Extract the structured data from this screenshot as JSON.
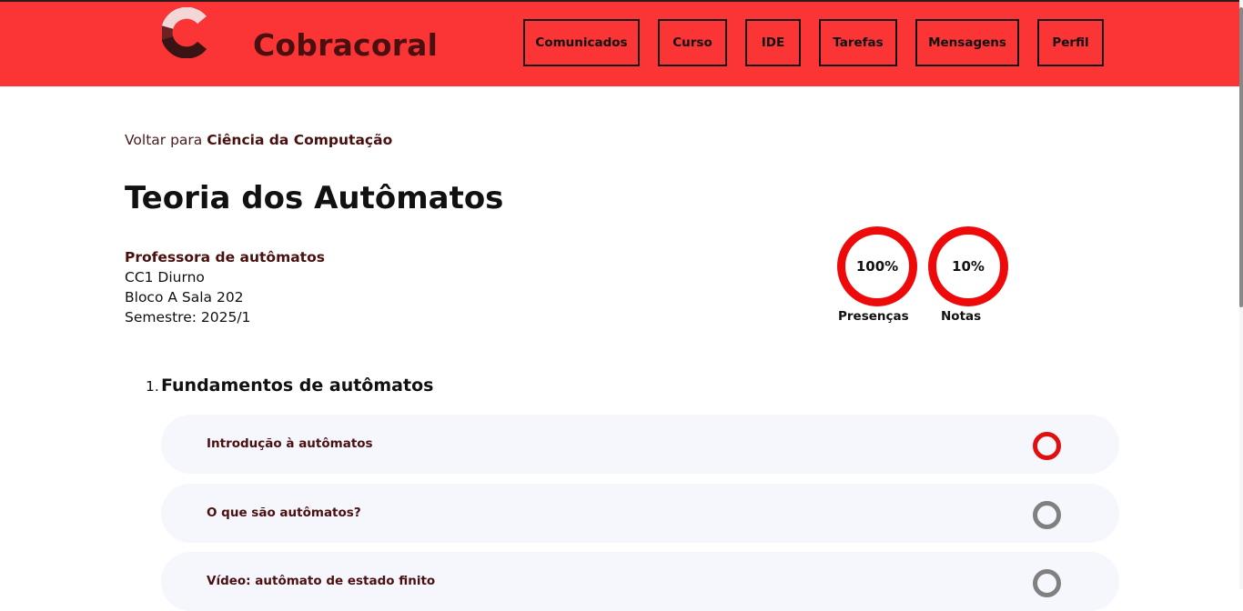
{
  "header": {
    "brand": "Cobracoral",
    "nav": [
      {
        "label": "Comunicados"
      },
      {
        "label": "Curso"
      },
      {
        "label": "IDE"
      },
      {
        "label": "Tarefas"
      },
      {
        "label": "Mensagens"
      },
      {
        "label": "Perfil"
      }
    ]
  },
  "breadcrumb": {
    "prefix": "Voltar para ",
    "link": "Ciência da Computação"
  },
  "course": {
    "title": "Teoria dos Autômatos",
    "professor": "Professora de autômatos",
    "class": "CC1 Diurno",
    "room": "Bloco A Sala 202",
    "semester": "Semestre: 2025/1"
  },
  "stats": {
    "attendance": {
      "value": "100%",
      "label": "Presenças",
      "fraction": 1.0
    },
    "grades": {
      "value": "10%",
      "label": "Notas",
      "fraction": 0.1
    }
  },
  "sections": [
    {
      "number": "1.",
      "title": "Fundamentos de autômatos",
      "lessons": [
        {
          "title": "Introdução à autômatos",
          "status": "active"
        },
        {
          "title": "O que são autômatos?",
          "status": "pending"
        },
        {
          "title": "Vídeo: autômato de estado finito",
          "status": "pending"
        }
      ]
    }
  ],
  "colors": {
    "header_bg": "#fb3535",
    "ring": "#ee0a0a",
    "brand_text": "#4a1010",
    "lesson_bg": "#f6f6fd",
    "status_active": "#e01010",
    "status_pending": "#808080"
  },
  "icons": {
    "logo": "cobracoral-logo-icon",
    "status_active": "status-active-ring-icon",
    "status_pending": "status-pending-ring-icon"
  }
}
